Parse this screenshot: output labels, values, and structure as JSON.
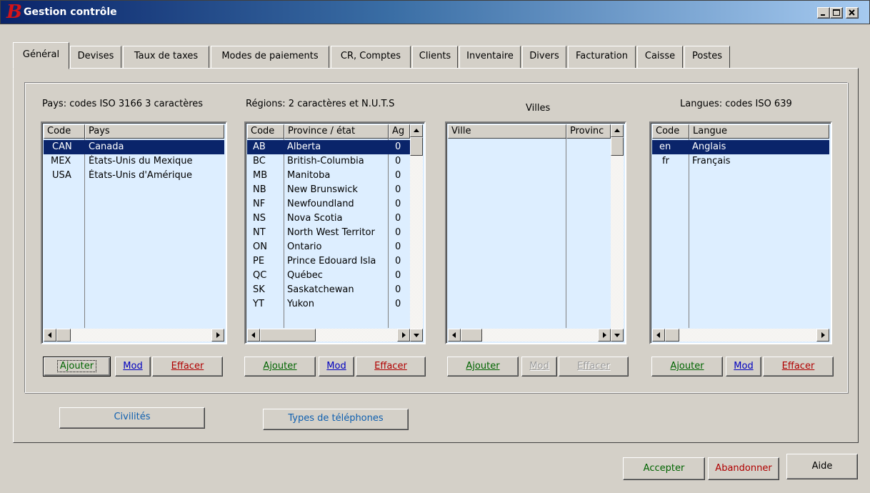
{
  "window": {
    "title": "Gestion contrôle",
    "logo_letter": "B",
    "controls": [
      "minimize",
      "maximize",
      "close"
    ]
  },
  "tabs": [
    "Général",
    "Devises",
    "Taux de taxes",
    "Modes de paiements",
    "CR, Comptes",
    "Clients",
    "Inventaire",
    "Divers",
    "Facturation",
    "Caisse",
    "Postes"
  ],
  "active_tab": "Général",
  "countries": {
    "heading": "Pays: codes ISO 3166 3 caractères",
    "columns": [
      "Code",
      "Pays"
    ],
    "rows": [
      {
        "code": "CAN",
        "name": "Canada",
        "selected": true
      },
      {
        "code": "MEX",
        "name": "États-Unis du Mexique",
        "selected": false
      },
      {
        "code": "USA",
        "name": "États-Unis d'Amérique",
        "selected": false
      }
    ],
    "buttons": {
      "add": "Ajouter",
      "mod": "Mod",
      "delete": "Effacer"
    }
  },
  "regions": {
    "heading": "Régions: 2 caractères et N.U.T.S",
    "columns": [
      "Code",
      "Province / état",
      "Ag"
    ],
    "rows": [
      {
        "code": "AB",
        "name": "Alberta",
        "ag": "0",
        "selected": true
      },
      {
        "code": "BC",
        "name": "British-Columbia",
        "ag": "0",
        "selected": false
      },
      {
        "code": "MB",
        "name": "Manitoba",
        "ag": "0",
        "selected": false
      },
      {
        "code": "NB",
        "name": "New Brunswick",
        "ag": "0",
        "selected": false
      },
      {
        "code": "NF",
        "name": "Newfoundland",
        "ag": "0",
        "selected": false
      },
      {
        "code": "NS",
        "name": "Nova Scotia",
        "ag": "0",
        "selected": false
      },
      {
        "code": "NT",
        "name": "North West Territor",
        "ag": "0",
        "selected": false
      },
      {
        "code": "ON",
        "name": "Ontario",
        "ag": "0",
        "selected": false
      },
      {
        "code": "PE",
        "name": "Prince Edouard Isla",
        "ag": "0",
        "selected": false
      },
      {
        "code": "QC",
        "name": "Québec",
        "ag": "0",
        "selected": false
      },
      {
        "code": "SK",
        "name": "Saskatchewan",
        "ag": "0",
        "selected": false
      },
      {
        "code": "YT",
        "name": "Yukon",
        "ag": "0",
        "selected": false
      }
    ],
    "buttons": {
      "add": "Ajouter",
      "mod": "Mod",
      "delete": "Effacer"
    }
  },
  "cities": {
    "heading": "Villes",
    "columns": [
      "Ville",
      "Provinc"
    ],
    "rows": [],
    "buttons": {
      "add": "Ajouter",
      "mod": "Mod",
      "delete": "Effacer"
    }
  },
  "languages": {
    "heading": "Langues: codes ISO 639",
    "columns": [
      "Code",
      "Langue"
    ],
    "rows": [
      {
        "code": "en",
        "name": "Anglais",
        "selected": true
      },
      {
        "code": "fr",
        "name": "Français",
        "selected": false
      }
    ],
    "buttons": {
      "add": "Ajouter",
      "mod": "Mod",
      "delete": "Effacer"
    }
  },
  "extra_buttons": {
    "civilities": "Civilités",
    "phone_types": "Types de téléphones"
  },
  "footer": {
    "accept": "Accepter",
    "cancel": "Abandonner",
    "help": "Aide"
  },
  "colors": {
    "list_bg": "#ddeeff",
    "selection_bg": "#0a246a",
    "title_gradient_start": "#0a246a",
    "title_gradient_end": "#a6caf0",
    "add_color": "#006400",
    "mod_color": "#0000c0",
    "delete_color": "#b00000"
  }
}
